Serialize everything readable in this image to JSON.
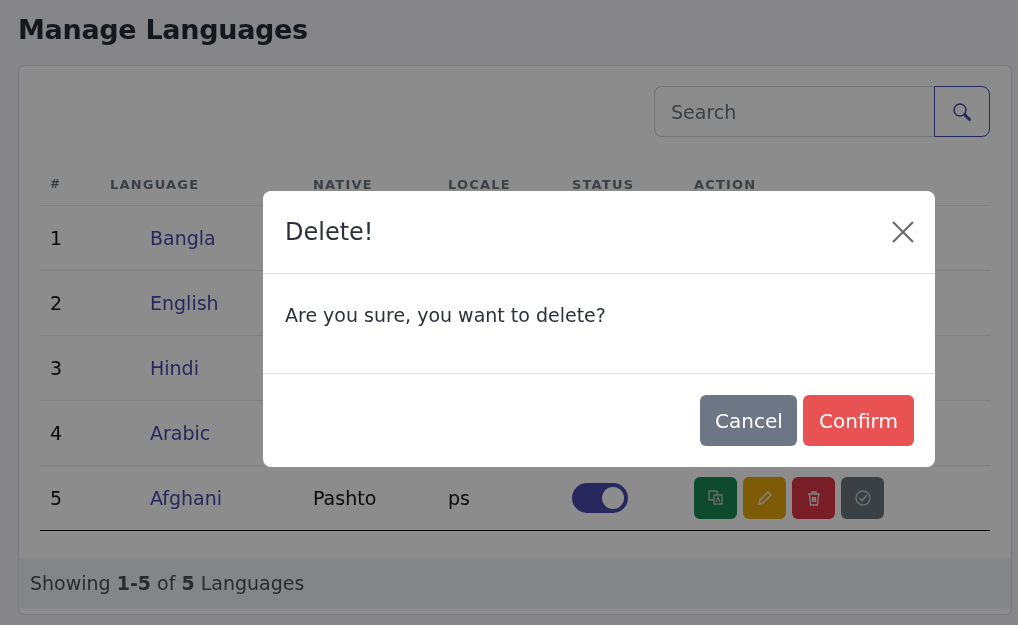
{
  "page": {
    "title": "Manage Languages"
  },
  "search": {
    "placeholder": "Search"
  },
  "table": {
    "columns": [
      "#",
      "LANGUAGE",
      "NATIVE",
      "LOCALE",
      "STATUS",
      "ACTION"
    ],
    "rows": [
      {
        "number": "1",
        "language": "Bangla"
      },
      {
        "number": "2",
        "language": "English"
      },
      {
        "number": "3",
        "language": "Hindi"
      },
      {
        "number": "4",
        "language": "Arabic"
      },
      {
        "number": "5",
        "language": "Afghani",
        "native": "Pashto",
        "locale": "ps",
        "status": {
          "on": true
        },
        "actions": [
          {
            "kind": "translate"
          },
          {
            "kind": "edit"
          },
          {
            "kind": "delete"
          },
          {
            "kind": "default"
          }
        ]
      }
    ]
  },
  "footer": {
    "text": "Showing **1-5** of **5** Languages"
  },
  "dialog": {
    "title": "Delete!",
    "message": "Are you sure, you want to delete?",
    "buttons": [
      {
        "kind": "cancel",
        "label": "Cancel"
      },
      {
        "kind": "confirm",
        "label": "Confirm"
      }
    ]
  }
}
